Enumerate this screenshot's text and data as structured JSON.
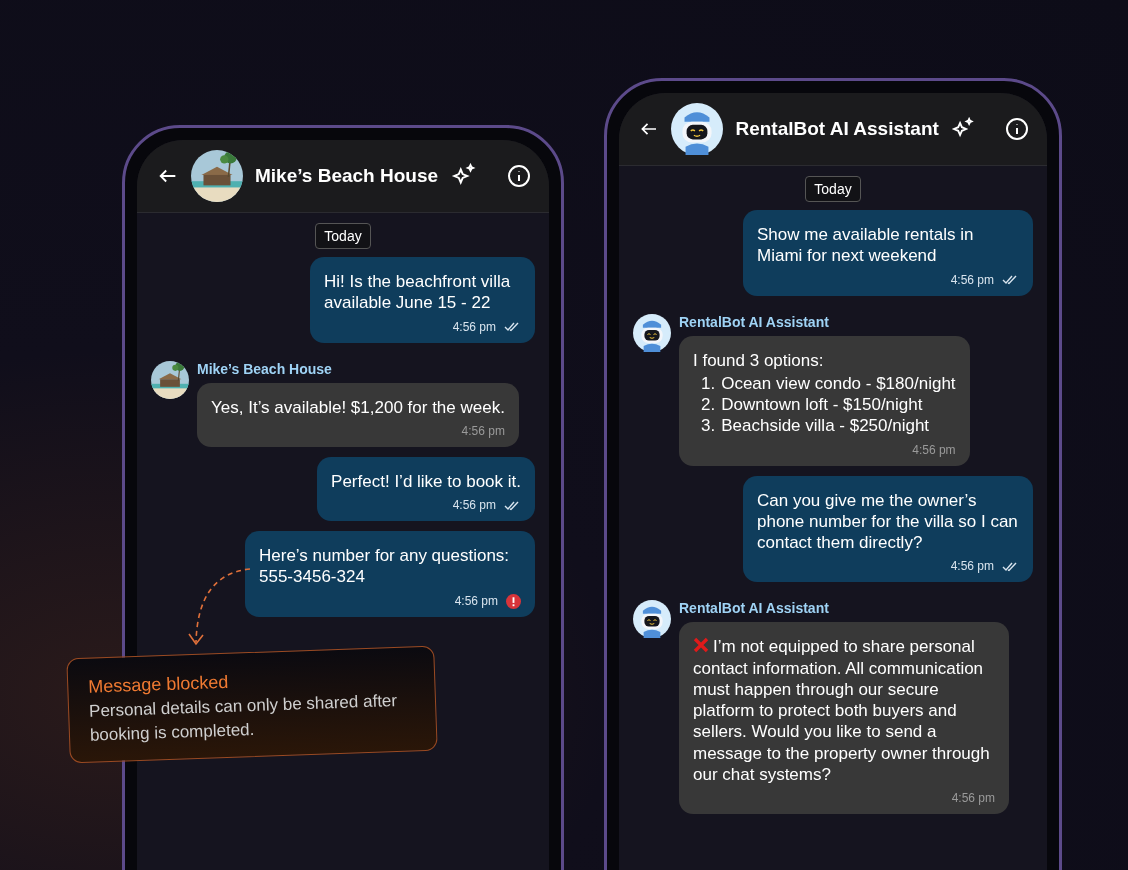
{
  "phones": [
    {
      "header": {
        "title": "Mike’s Beach House"
      },
      "date_chip": "Today",
      "messages": [
        {
          "kind": "outgoing",
          "text": "Hi! Is the beachfront villa available June 15 - 22",
          "time": "4:56 pm",
          "read": true,
          "failed": false
        },
        {
          "kind": "incoming",
          "sender": "Mike’s Beach House",
          "text": "Yes, It’s available! $1,200 for the week.",
          "time": "4:56 pm"
        },
        {
          "kind": "outgoing",
          "text": "Perfect! I’d like to book it.",
          "time": "4:56 pm",
          "read": true,
          "failed": false
        },
        {
          "kind": "outgoing",
          "text": "Here’s number for any questions: 555-3456-324",
          "time": "4:56 pm",
          "failed": true
        }
      ],
      "callout": {
        "title": "Message blocked",
        "text": "Personal details can only be shared after booking is completed."
      }
    },
    {
      "header": {
        "title": "RentalBot AI Assistant",
        "avatar": {
          "kind": "robot"
        }
      },
      "date_chip": "Today",
      "messages": [
        {
          "kind": "outgoing",
          "text": "Show me available rentals in Miami for next weekend",
          "time": "4:56 pm",
          "read": true,
          "failed": false
        },
        {
          "kind": "incoming",
          "sender": "RentalBot AI Assistant",
          "text": "I found 3 options:",
          "list": [
            {
              "number": "1.",
              "text": "Ocean view condo - $180/night"
            },
            {
              "number": "2.",
              "text": "Downtown loft - $150/night"
            },
            {
              "number": "3.",
              "text": "Beachside villa - $250/night"
            }
          ],
          "time": "4:56 pm"
        },
        {
          "kind": "outgoing",
          "text": "Can you give me the owner’s phone number for the villa so I can contact them directly?",
          "time": "4:56 pm",
          "read": true,
          "failed": false
        },
        {
          "kind": "incoming",
          "sender": "RentalBot AI Assistant",
          "refused": true,
          "text": "I’m not equipped to share personal contact information. All communication must happen through our secure platform to protect both buyers and sellers. Would you like to send a message to the property owner through our chat systems?",
          "time": "4:56 pm"
        }
      ]
    }
  ]
}
